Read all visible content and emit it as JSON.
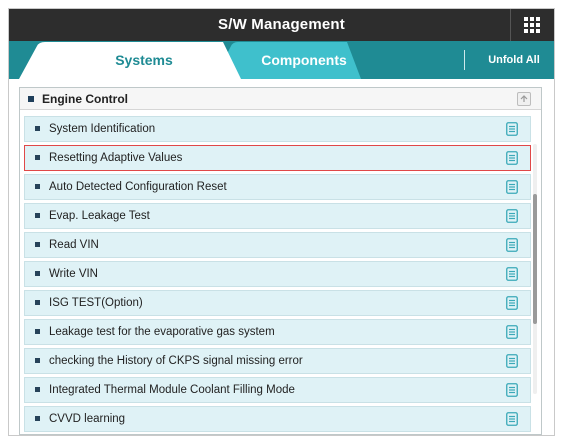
{
  "header": {
    "title": "S/W Management"
  },
  "tabs": [
    {
      "label": "Systems"
    },
    {
      "label": "Components"
    }
  ],
  "toolbar": {
    "unfold_label": "Unfold All"
  },
  "group": {
    "title": "Engine Control",
    "items": [
      {
        "label": "System Identification"
      },
      {
        "label": "Resetting Adaptive Values"
      },
      {
        "label": "Auto Detected Configuration Reset"
      },
      {
        "label": "Evap. Leakage Test"
      },
      {
        "label": "Read VIN"
      },
      {
        "label": "Write VIN"
      },
      {
        "label": "ISG TEST(Option)"
      },
      {
        "label": "Leakage test for the evaporative gas system"
      },
      {
        "label": "checking the History of  CKPS signal missing error"
      },
      {
        "label": "Integrated Thermal Module Coolant Filling Mode"
      },
      {
        "label": "CVVD learning"
      }
    ]
  },
  "colors": {
    "titlebar": "#2d2d2d",
    "accent": "#1f8b94",
    "row_bg": "#dff2f6",
    "selected_border": "#e04848"
  }
}
